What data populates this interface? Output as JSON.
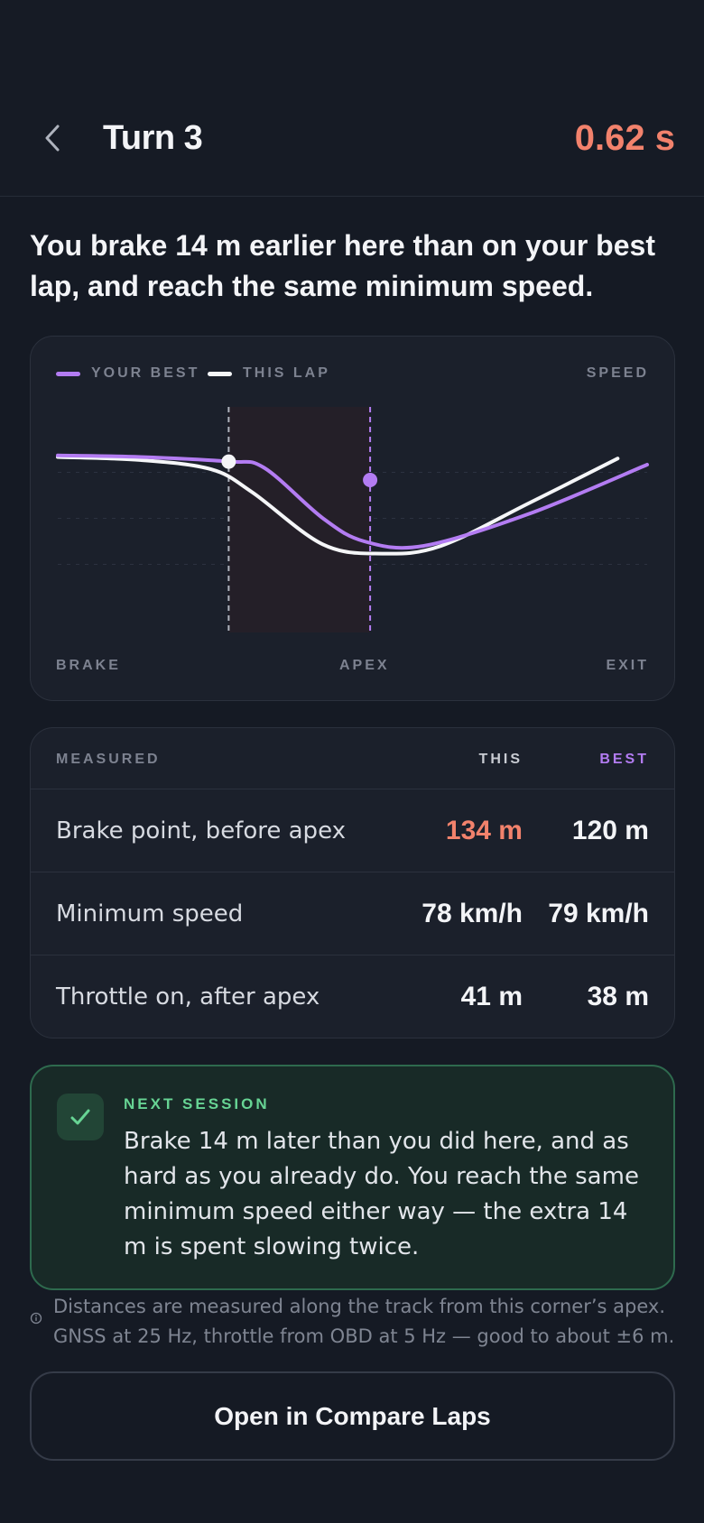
{
  "header": {
    "title": "Turn 3",
    "delta": "0.62 s"
  },
  "summary": "You brake 14 m earlier here than on your best lap, and reach the same minimum speed.",
  "chart": {
    "legend": {
      "best_label": "YOUR BEST",
      "this_label": "THIS LAP",
      "metric_label": "SPEED"
    },
    "colors": {
      "best": "#b37cf2",
      "this": "#f5f6f8",
      "zone": "#241f28"
    },
    "axis_labels": [
      "BRAKE",
      "APEX",
      "EXIT"
    ]
  },
  "chart_data": {
    "type": "line",
    "ylabel": "SPEED",
    "x_axis_labels": [
      "BRAKE",
      "APEX",
      "EXIT"
    ],
    "grid": true,
    "series": [
      {
        "name": "YOUR BEST",
        "values": [
          [
            0,
            0.86
          ],
          [
            0.14,
            0.85
          ],
          [
            0.29,
            0.82
          ],
          [
            0.35,
            0.78
          ],
          [
            0.45,
            0.45
          ],
          [
            0.52,
            0.3
          ],
          [
            0.62,
            0.27
          ],
          [
            0.8,
            0.48
          ],
          [
            1.0,
            0.8
          ]
        ],
        "marker": [
          0.5,
          0.7
        ]
      },
      {
        "name": "THIS LAP",
        "values": [
          [
            0,
            0.85
          ],
          [
            0.14,
            0.83
          ],
          [
            0.26,
            0.77
          ],
          [
            0.33,
            0.62
          ],
          [
            0.45,
            0.28
          ],
          [
            0.55,
            0.22
          ],
          [
            0.65,
            0.27
          ],
          [
            0.8,
            0.55
          ],
          [
            0.95,
            0.84
          ]
        ],
        "marker": [
          0.29,
          0.82
        ]
      }
    ],
    "highlight_zone": [
      0.29,
      0.53
    ]
  },
  "table": {
    "header": {
      "label": "MEASURED",
      "this": "THIS",
      "best": "BEST"
    },
    "rows": [
      {
        "label": "Brake point, before apex",
        "this": "134 m",
        "best": "120 m",
        "this_highlight": true
      },
      {
        "label": "Minimum speed",
        "this": "78 km/h",
        "best": "79 km/h",
        "this_highlight": false
      },
      {
        "label": "Throttle on, after apex",
        "this": "41 m",
        "best": "38 m",
        "this_highlight": false
      }
    ]
  },
  "next_session": {
    "label": "NEXT SESSION",
    "text": "Brake 14 m later than you did here, and as hard as you already do. You reach the same minimum speed either way — the extra 14 m is spent slowing twice."
  },
  "note": "Distances are measured along the track from this corner’s apex. GNSS at 25 Hz, throttle from OBD at 5 Hz — good to about ±6 m.",
  "actions": {
    "compare_label": "Open in Compare Laps"
  },
  "colors": {
    "background": "#151a24",
    "accent_delta": "#f2826c",
    "accent_best": "#b37cf2",
    "accent_success": "#67d494"
  }
}
